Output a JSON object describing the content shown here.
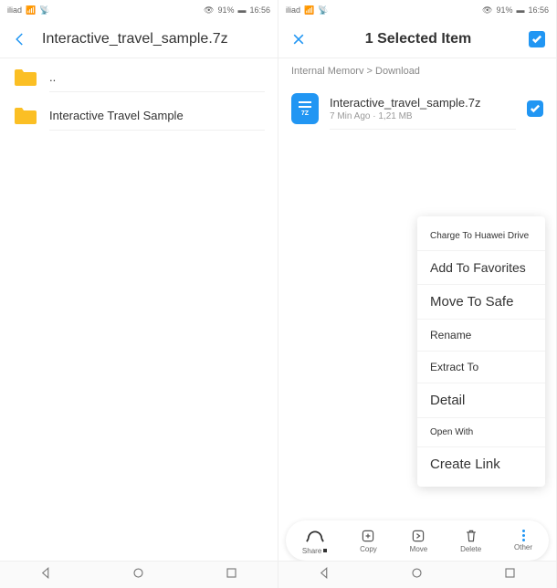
{
  "status": {
    "carrier": "iliad",
    "battery_pct": "91%",
    "time": "16:56"
  },
  "left": {
    "title": "Interactive_travel_sample.7z",
    "items": [
      {
        "name": ".."
      },
      {
        "name": "Interactive Travel Sample"
      }
    ]
  },
  "right": {
    "title": "1 Selected Item",
    "breadcrumb": "Internal Memorv > Download",
    "file": {
      "name": "Interactive_travel_sample.7z",
      "meta": "7 Min Ago · 1,21 MB",
      "icon_label": "7Z"
    },
    "menu": {
      "charge": "Charge To Huawei Drive",
      "favorites": "Add To Favorites",
      "safe": "Move To Safe",
      "rename": "Rename",
      "extract": "Extract To",
      "detail": "Detail",
      "open": "Open With",
      "create": "Create Link"
    },
    "actions": {
      "share": "Share",
      "copy": "Copy",
      "move": "Move",
      "delete": "Delete",
      "other": "Other"
    }
  }
}
